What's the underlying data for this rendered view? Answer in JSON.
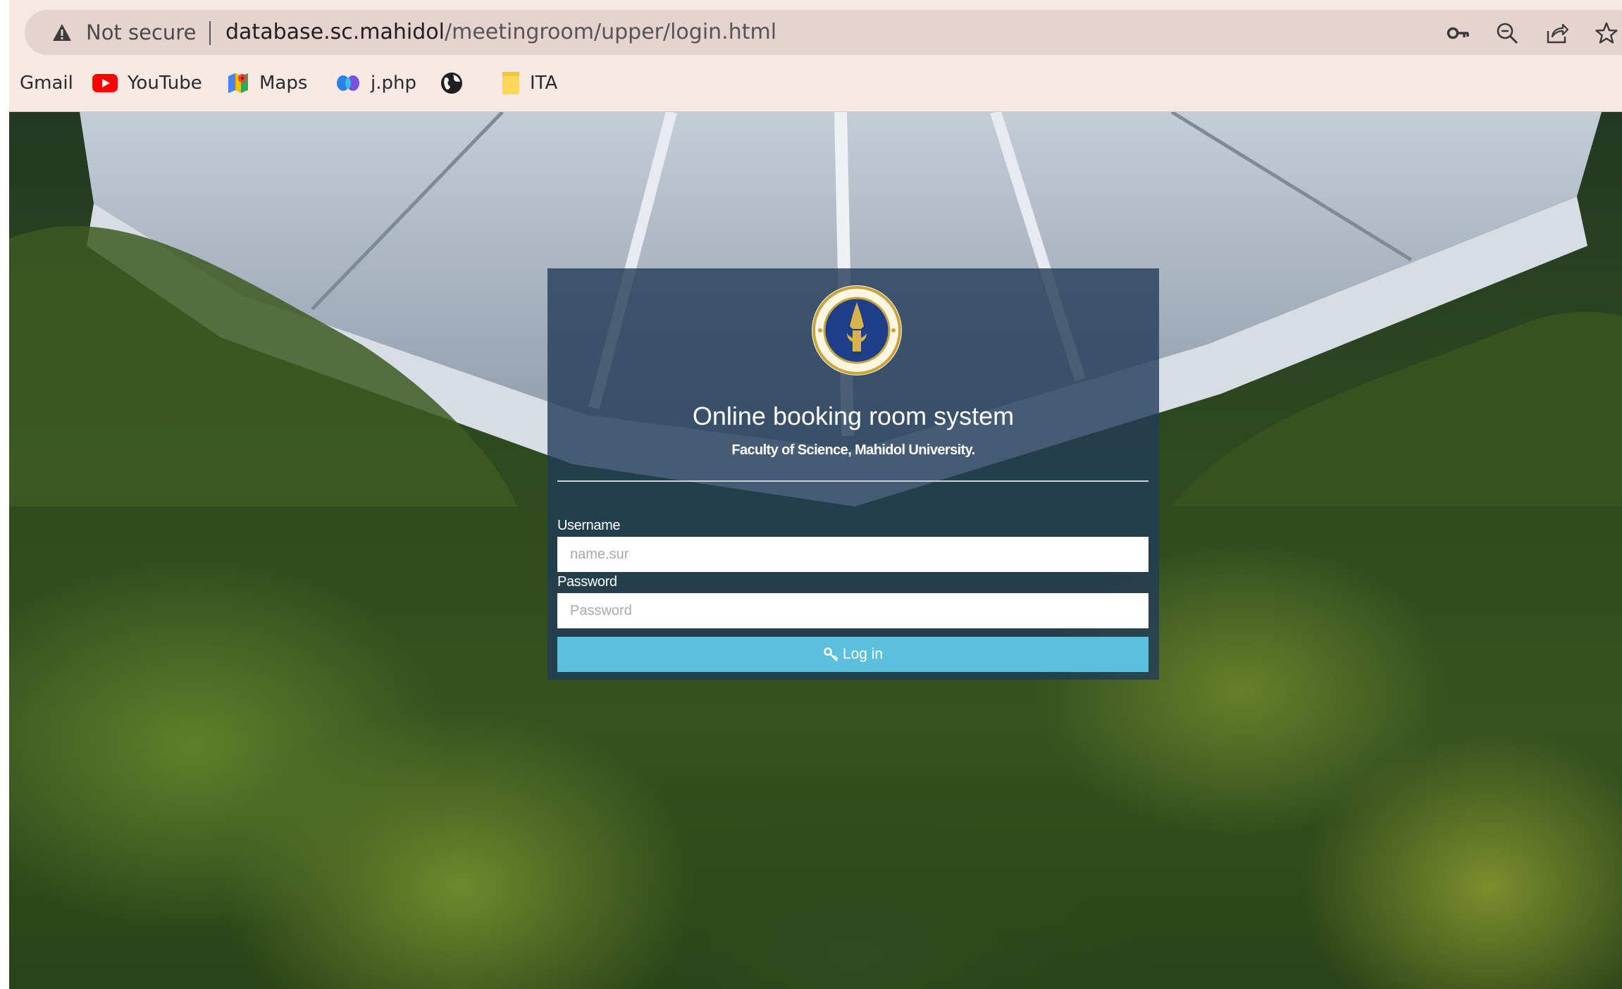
{
  "browser": {
    "security_label": "Not secure",
    "url_host": "database.sc.mahidol",
    "url_path": "/meetingroom/upper/login.html",
    "icons": [
      "warning-icon",
      "key-icon",
      "zoom-icon",
      "share-icon",
      "star-icon"
    ]
  },
  "bookmarks": {
    "items": [
      {
        "label": "Gmail",
        "icon": ""
      },
      {
        "label": "YouTube",
        "icon": "youtube-icon"
      },
      {
        "label": "Maps",
        "icon": "maps-icon"
      },
      {
        "label": "j.php",
        "icon": "copilot-icon"
      },
      {
        "label": "",
        "icon": "globe-icon"
      },
      {
        "label": "ITA",
        "icon": "folder-icon"
      }
    ]
  },
  "login": {
    "title": "Online booking room system",
    "subtitle": "Faculty of Science, Mahidol University.",
    "username_label": "Username",
    "username_placeholder": "name.sur",
    "username_value": "",
    "password_label": "Password",
    "password_placeholder": "Password",
    "password_value": "",
    "submit_label": "Log in",
    "submit_icon": "key-icon",
    "logo": "mahidol-university-seal"
  },
  "colors": {
    "chrome_bg": "#f7e8e4",
    "omnibox_bg": "#e6d3cf",
    "card_bg": "#223c58",
    "button_bg": "#5bc0de",
    "seal_blue": "#1d3f8a",
    "seal_gold": "#c9a33b"
  }
}
